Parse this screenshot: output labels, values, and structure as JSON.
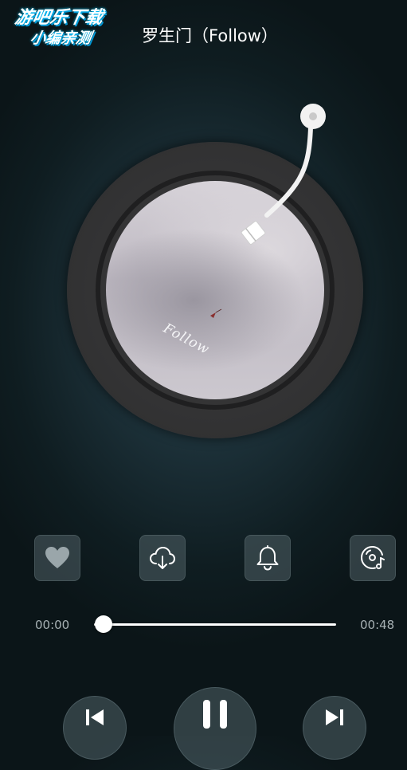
{
  "watermark": {
    "line1": "游吧乐下载",
    "line2": "小编亲测"
  },
  "player": {
    "song_title": "罗生门（Follow）",
    "album_script": "Follow",
    "progress": {
      "current_time": "00:00",
      "total_time": "00:48",
      "fraction": 0.04
    }
  },
  "actions": [
    {
      "name": "favorite",
      "icon": "heart-icon"
    },
    {
      "name": "download",
      "icon": "cloud-download-icon"
    },
    {
      "name": "ringtone",
      "icon": "bell-icon"
    },
    {
      "name": "music-disc",
      "icon": "disc-music-icon"
    }
  ],
  "controls": [
    {
      "name": "previous",
      "icon": "skip-previous-icon"
    },
    {
      "name": "pause",
      "icon": "pause-icon"
    },
    {
      "name": "next",
      "icon": "skip-next-icon"
    }
  ],
  "colors": {
    "background": "#0f1d21",
    "accent": "#ffffff",
    "vinyl": "#333334"
  }
}
